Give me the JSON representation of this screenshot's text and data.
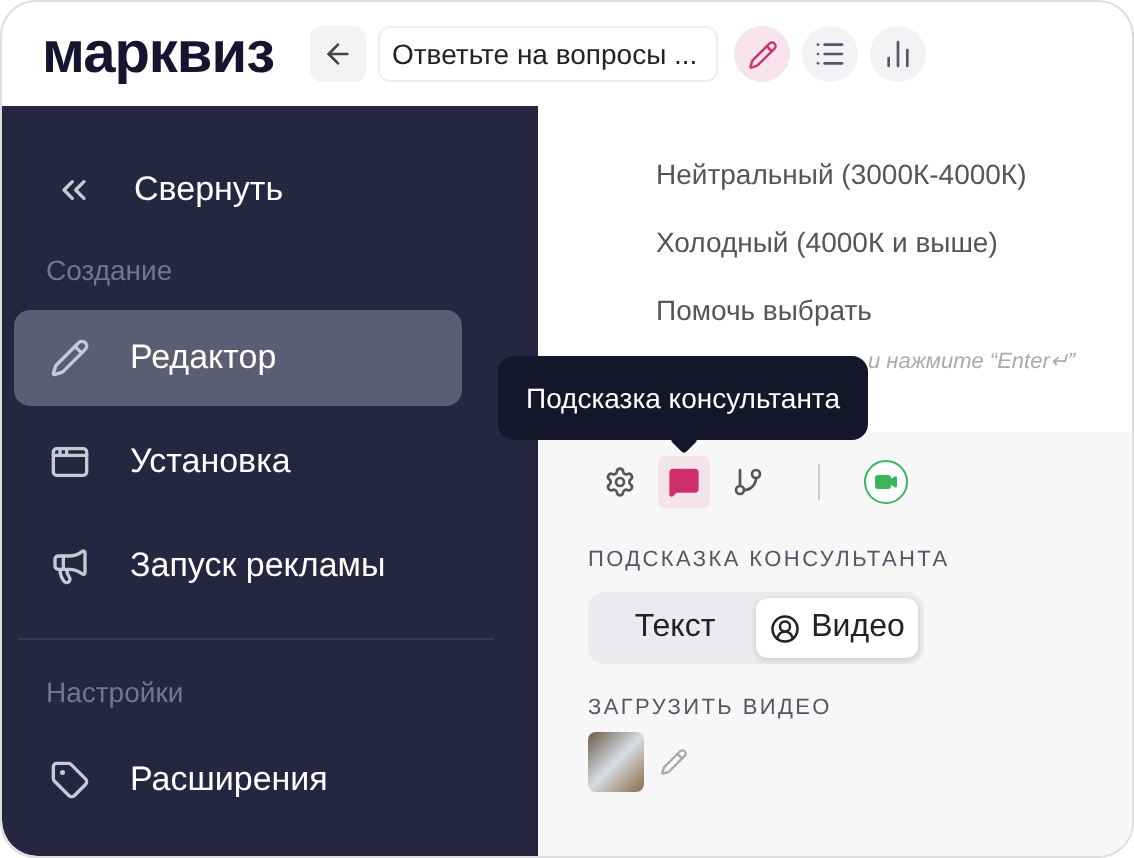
{
  "header": {
    "logo": "марквиз",
    "title_field": {
      "value": "Ответьте на вопросы ..."
    },
    "view_buttons": [
      {
        "kind": "editor",
        "selected": true
      },
      {
        "kind": "list",
        "selected": false
      },
      {
        "kind": "stats",
        "selected": false
      }
    ]
  },
  "sidebar": {
    "collapse": "Свернуть",
    "sections": [
      {
        "title": "Создание",
        "items": [
          {
            "kind": "editor",
            "label": "Редактор",
            "selected": true
          },
          {
            "kind": "install",
            "label": "Установка",
            "selected": false
          },
          {
            "kind": "ads",
            "label": "Запуск рекламы",
            "selected": false
          }
        ]
      },
      {
        "title": "Настройки",
        "items": [
          {
            "kind": "extensions",
            "label": "Расширения",
            "selected": false
          }
        ]
      }
    ]
  },
  "question": {
    "options": [
      "Нейтральный (3000К-4000К)",
      "Холодный (4000К и выше)",
      "Помочь выбрать"
    ],
    "hint": "и нажмите “Enter↵”"
  },
  "tooltip": "Подсказка консультанта",
  "toolbar": {
    "tools": [
      {
        "kind": "settings",
        "selected": false
      },
      {
        "kind": "hint",
        "selected": true
      },
      {
        "kind": "branch",
        "selected": false
      }
    ],
    "camera_on": true
  },
  "hint_panel": {
    "heading": "ПОДСКАЗКА КОНСУЛЬТАНТА",
    "tabs": [
      {
        "kind": "text",
        "label": "Текст",
        "selected": false
      },
      {
        "kind": "video",
        "label": "Видео",
        "selected": true
      }
    ],
    "upload_label": "ЗАГРУЗИТЬ ВИДЕО"
  }
}
